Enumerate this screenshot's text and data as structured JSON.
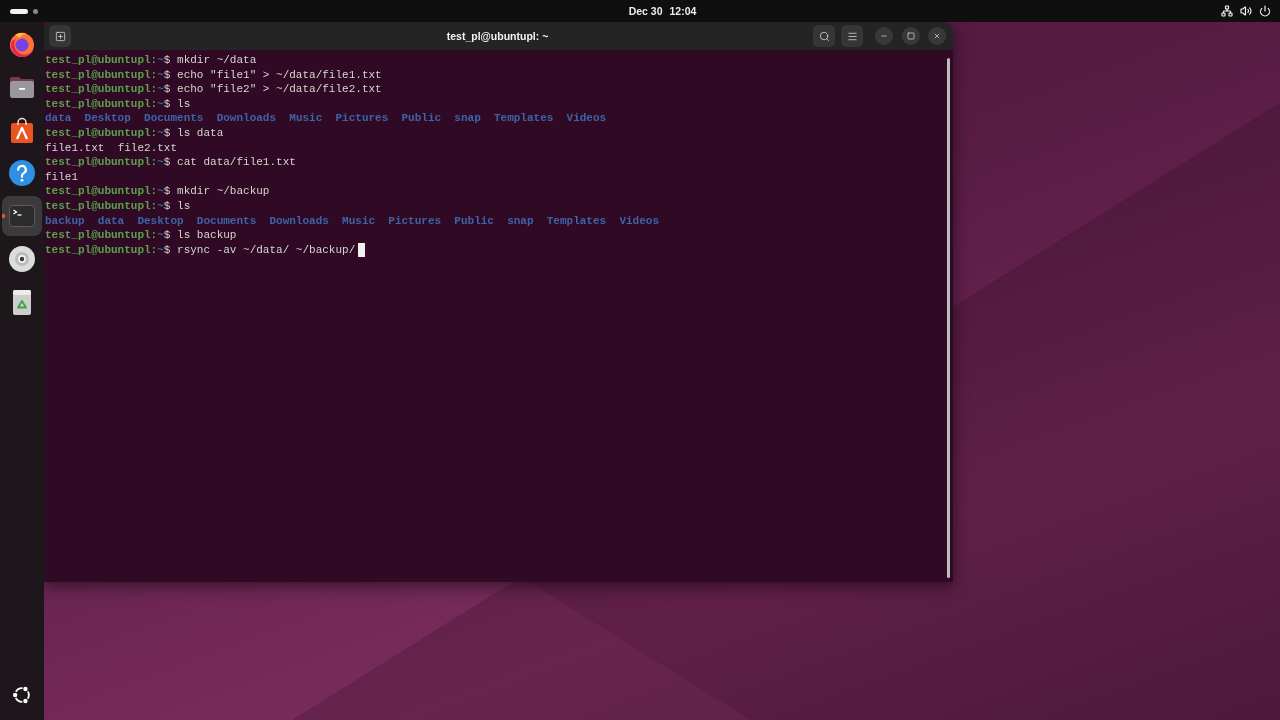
{
  "top_bar": {
    "workspaces": [
      {
        "selected": true
      },
      {
        "selected": false
      }
    ],
    "date": "Dec 30",
    "time": "12:04"
  },
  "dock": {
    "items": [
      {
        "kind": "browser",
        "active": false
      },
      {
        "kind": "files",
        "active": false
      },
      {
        "kind": "app_store",
        "active": false
      },
      {
        "kind": "help",
        "active": false
      },
      {
        "kind": "terminal",
        "active": true
      },
      {
        "kind": "disc",
        "active": false
      },
      {
        "kind": "trash",
        "active": false
      }
    ]
  },
  "terminal": {
    "title": "test_pl@ubuntupl: ~",
    "lines": [
      {
        "kind": "prompt",
        "user": "test_pl@ubuntupl:",
        "cwd": "~",
        "sign": "$",
        "command": "mkdir ~/data",
        "cursor": false
      },
      {
        "kind": "prompt",
        "user": "test_pl@ubuntupl:",
        "cwd": "~",
        "sign": "$",
        "command": "echo \"file1\" > ~/data/file1.txt",
        "cursor": false
      },
      {
        "kind": "prompt",
        "user": "test_pl@ubuntupl:",
        "cwd": "~",
        "sign": "$",
        "command": "echo \"file2\" > ~/data/file2.txt",
        "cursor": false
      },
      {
        "kind": "prompt",
        "user": "test_pl@ubuntupl:",
        "cwd": "~",
        "sign": "$",
        "command": "ls",
        "cursor": false
      },
      {
        "kind": "listing",
        "entries": [
          {
            "name": "data",
            "kind": "dir"
          },
          {
            "name": "Desktop",
            "kind": "dir"
          },
          {
            "name": "Documents",
            "kind": "dir"
          },
          {
            "name": "Downloads",
            "kind": "dir"
          },
          {
            "name": "Music",
            "kind": "dir"
          },
          {
            "name": "Pictures",
            "kind": "dir"
          },
          {
            "name": "Public",
            "kind": "dir"
          },
          {
            "name": "snap",
            "kind": "dir"
          },
          {
            "name": "Templates",
            "kind": "dir"
          },
          {
            "name": "Videos",
            "kind": "dir"
          }
        ],
        "cursor": false
      },
      {
        "kind": "prompt",
        "user": "test_pl@ubuntupl:",
        "cwd": "~",
        "sign": "$",
        "command": "ls data",
        "cursor": false
      },
      {
        "kind": "listing",
        "entries": [
          {
            "name": "file1.txt",
            "kind": "file"
          },
          {
            "name": "file2.txt",
            "kind": "file"
          }
        ],
        "cursor": false
      },
      {
        "kind": "prompt",
        "user": "test_pl@ubuntupl:",
        "cwd": "~",
        "sign": "$",
        "command": "cat data/file1.txt",
        "cursor": false
      },
      {
        "kind": "output",
        "text": "file1",
        "cursor": false
      },
      {
        "kind": "prompt",
        "user": "test_pl@ubuntupl:",
        "cwd": "~",
        "sign": "$",
        "command": "mkdir ~/backup",
        "cursor": false
      },
      {
        "kind": "prompt",
        "user": "test_pl@ubuntupl:",
        "cwd": "~",
        "sign": "$",
        "command": "ls",
        "cursor": false
      },
      {
        "kind": "listing",
        "entries": [
          {
            "name": "backup",
            "kind": "dir"
          },
          {
            "name": "data",
            "kind": "dir"
          },
          {
            "name": "Desktop",
            "kind": "dir"
          },
          {
            "name": "Documents",
            "kind": "dir"
          },
          {
            "name": "Downloads",
            "kind": "dir"
          },
          {
            "name": "Music",
            "kind": "dir"
          },
          {
            "name": "Pictures",
            "kind": "dir"
          },
          {
            "name": "Public",
            "kind": "dir"
          },
          {
            "name": "snap",
            "kind": "dir"
          },
          {
            "name": "Templates",
            "kind": "dir"
          },
          {
            "name": "Videos",
            "kind": "dir"
          }
        ],
        "cursor": false
      },
      {
        "kind": "prompt",
        "user": "test_pl@ubuntupl:",
        "cwd": "~",
        "sign": "$",
        "command": "ls backup",
        "cursor": false
      },
      {
        "kind": "prompt",
        "user": "test_pl@ubuntupl:",
        "cwd": "~",
        "sign": "$",
        "command": "rsync -av ~/data/ ~/backup/",
        "cursor": true
      }
    ]
  }
}
